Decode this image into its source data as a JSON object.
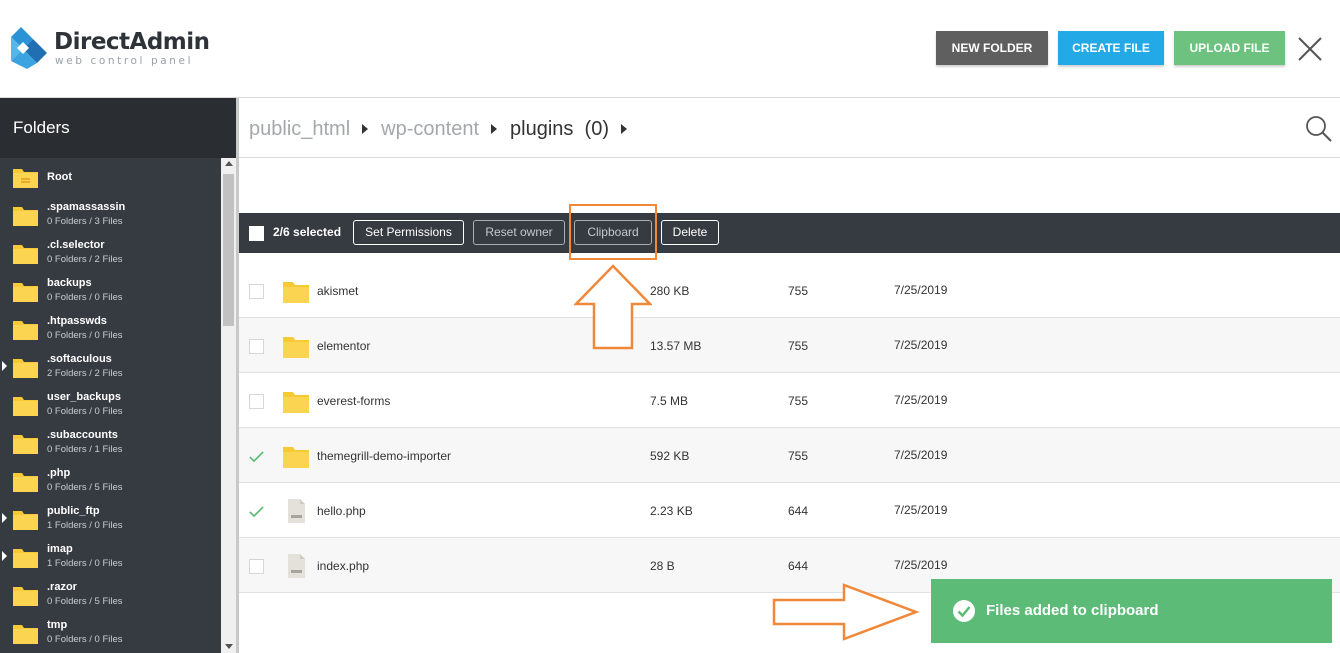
{
  "app": {
    "brand": "DirectAdmin",
    "tagline": "web control panel"
  },
  "header": {
    "new_folder": "NEW FOLDER",
    "create_file": "CREATE FILE",
    "upload_file": "UPLOAD FILE"
  },
  "sidebar": {
    "title": "Folders",
    "items": [
      {
        "name": "Root",
        "meta": ""
      },
      {
        "name": ".spamassassin",
        "meta": "0 Folders / 3 Files"
      },
      {
        "name": ".cl.selector",
        "meta": "0 Folders / 2 Files"
      },
      {
        "name": "backups",
        "meta": "0 Folders / 0 Files"
      },
      {
        "name": ".htpasswds",
        "meta": "0 Folders / 0 Files"
      },
      {
        "name": ".softaculous",
        "meta": "2 Folders / 2 Files"
      },
      {
        "name": "user_backups",
        "meta": "0 Folders / 0 Files"
      },
      {
        "name": ".subaccounts",
        "meta": "0 Folders / 1 Files"
      },
      {
        "name": ".php",
        "meta": "0 Folders / 5 Files"
      },
      {
        "name": "public_ftp",
        "meta": "1 Folders / 0 Files"
      },
      {
        "name": "imap",
        "meta": "1 Folders / 0 Files"
      },
      {
        "name": ".razor",
        "meta": "0 Folders / 5 Files"
      },
      {
        "name": "tmp",
        "meta": "0 Folders / 0 Files"
      }
    ]
  },
  "breadcrumb": {
    "crumbs": [
      "public_html",
      "wp-content"
    ],
    "current": "plugins",
    "count": "(0)"
  },
  "toolbar": {
    "selected": "2/6 selected",
    "set_permissions": "Set Permissions",
    "reset_owner": "Reset owner",
    "clipboard": "Clipboard",
    "delete": "Delete"
  },
  "files": [
    {
      "name": "akismet",
      "size": "280 KB",
      "perm": "755",
      "date": "7/25/2019",
      "type": "folder",
      "checked": false
    },
    {
      "name": "elementor",
      "size": "13.57 MB",
      "perm": "755",
      "date": "7/25/2019",
      "type": "folder",
      "checked": false
    },
    {
      "name": "everest-forms",
      "size": "7.5 MB",
      "perm": "755",
      "date": "7/25/2019",
      "type": "folder",
      "checked": false
    },
    {
      "name": "themegrill-demo-importer",
      "size": "592 KB",
      "perm": "755",
      "date": "7/25/2019",
      "type": "folder",
      "checked": true
    },
    {
      "name": "hello.php",
      "size": "2.23 KB",
      "perm": "644",
      "date": "7/25/2019",
      "type": "file",
      "checked": true
    },
    {
      "name": "index.php",
      "size": "28 B",
      "perm": "644",
      "date": "7/25/2019",
      "type": "file",
      "checked": false
    }
  ],
  "toast": {
    "message": "Files added to clipboard"
  },
  "colors": {
    "new_folder_button": "#5f5f5f",
    "create_file_button": "#23a9e6",
    "upload_file_button": "#6cc27e",
    "sidebar_bg": "#363b41",
    "toast_bg": "#5cbb76",
    "annotation": "#f0883a",
    "folder_icon": "#f7c934"
  }
}
